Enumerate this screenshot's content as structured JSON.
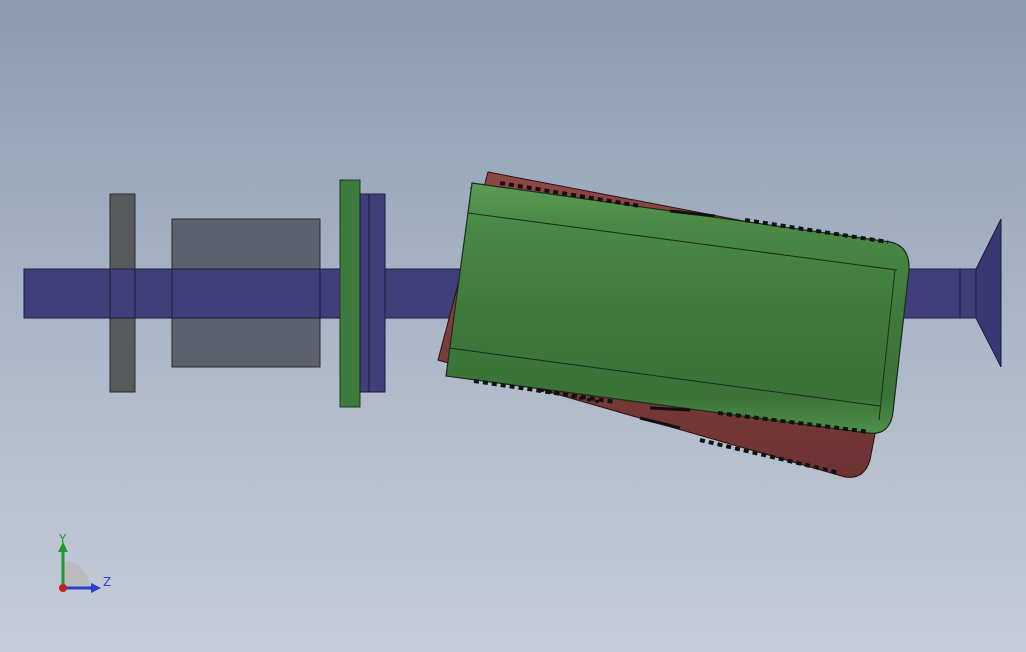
{
  "viewport": {
    "background_top": "#8a9bb1",
    "background_bottom": "#c6ccd9"
  },
  "model": {
    "parts": [
      {
        "name": "shaft",
        "color": "#403f7c"
      },
      {
        "name": "left-flange",
        "color": "#58595b"
      },
      {
        "name": "motor-block",
        "color": "#5d616e"
      },
      {
        "name": "green-plate",
        "color": "#3e7a3c"
      },
      {
        "name": "blue-plate",
        "color": "#403f7c"
      },
      {
        "name": "cone-end",
        "color": "#3a3870"
      },
      {
        "name": "red-cylinder-body",
        "color": "#7a3a3a"
      },
      {
        "name": "green-cylinder-body",
        "color": "#427a3f"
      }
    ]
  },
  "triad": {
    "y_label": "Y",
    "z_label": "Z",
    "y_color": "#1a9a2a",
    "z_color": "#2a3fd0",
    "origin_color": "#c02020"
  }
}
